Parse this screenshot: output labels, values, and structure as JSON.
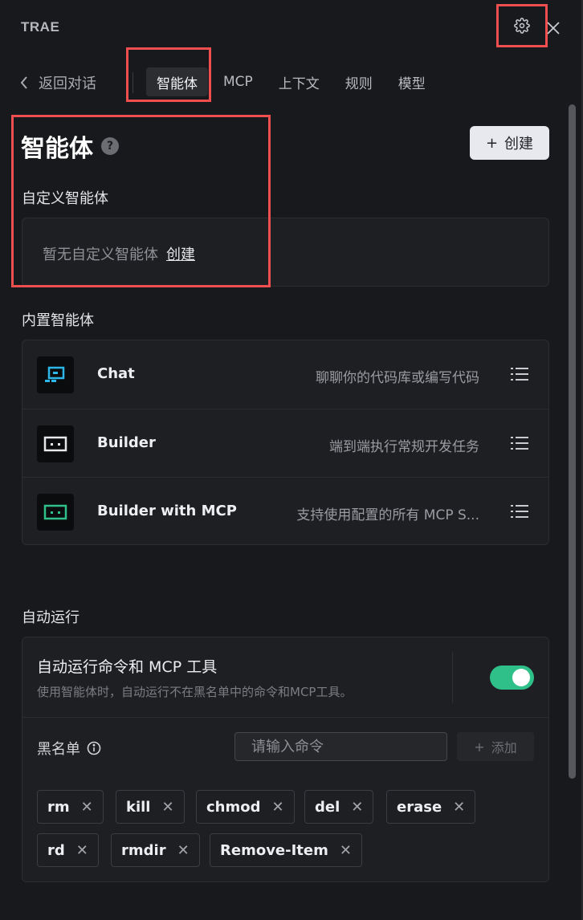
{
  "app": {
    "title": "TRAE"
  },
  "nav": {
    "back_label": "返回对话",
    "tabs": [
      {
        "label": "智能体",
        "active": true
      },
      {
        "label": "MCP"
      },
      {
        "label": "上下文"
      },
      {
        "label": "规则"
      },
      {
        "label": "模型"
      }
    ]
  },
  "agents_section": {
    "title": "智能体",
    "help": "?",
    "create_button": "创建",
    "custom": {
      "label": "自定义智能体",
      "empty_text": "暂无自定义智能体",
      "create_link": "创建"
    },
    "builtin": {
      "label": "内置智能体",
      "items": [
        {
          "name": "Chat",
          "description": "聊聊你的代码库或编写代码",
          "icon": "chat-agent-icon",
          "accent": "#2db7e8"
        },
        {
          "name": "Builder",
          "description": "端到端执行常规开发任务",
          "icon": "builder-agent-icon",
          "accent": "#e6e7ea"
        },
        {
          "name": "Builder with MCP",
          "description": "支持使用配置的所有 MCP S...",
          "icon": "builder-mcp-agent-icon",
          "accent": "#2fc089"
        }
      ]
    }
  },
  "auto_run": {
    "label": "自动运行",
    "title": "自动运行命令和 MCP 工具",
    "description": "使用智能体时，自动运行不在黑名单中的命令和MCP工具。",
    "enabled": true,
    "blacklist": {
      "label": "黑名单",
      "input_placeholder": "请输入命令",
      "add_button": "添加",
      "tags": [
        "rm",
        "kill",
        "chmod",
        "del",
        "erase",
        "rd",
        "rmdir",
        "Remove-Item"
      ]
    }
  },
  "colors": {
    "accent_highlight": "#ef4f4f",
    "toggle_on": "#2fc089"
  }
}
